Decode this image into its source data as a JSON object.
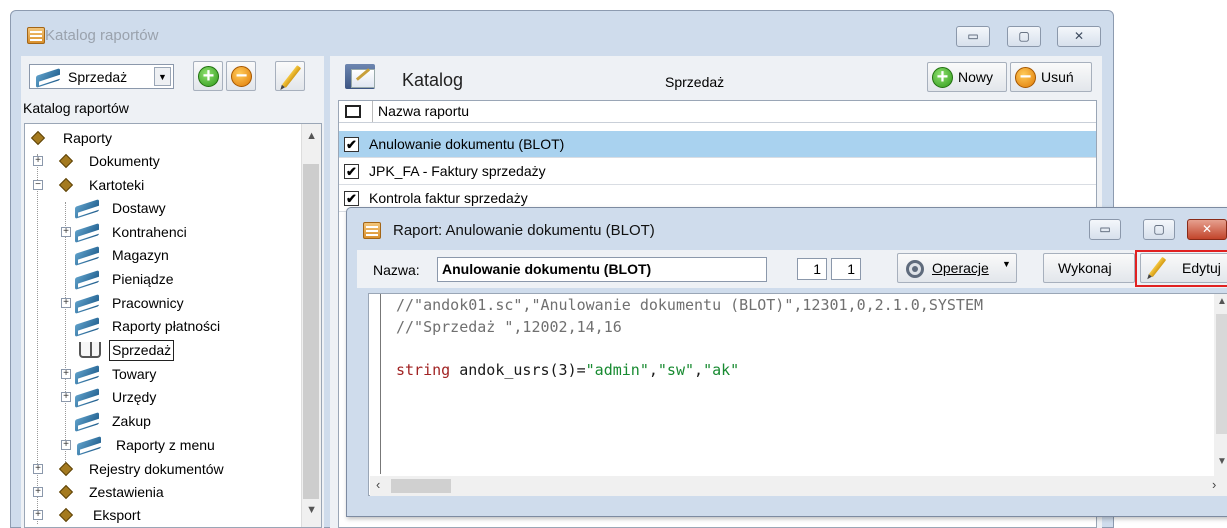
{
  "main_window": {
    "title": "Katalog raportów",
    "min": "▭",
    "max": "▢",
    "close": "✕"
  },
  "left_panel": {
    "combo_value": "Sprzedaż",
    "header": "Katalog raportów",
    "tree": [
      {
        "label": "Raporty"
      },
      {
        "label": "Dokumenty"
      },
      {
        "label": "Kartoteki"
      },
      {
        "label": "Dostawy"
      },
      {
        "label": "Kontrahenci"
      },
      {
        "label": "Magazyn"
      },
      {
        "label": "Pieniądze"
      },
      {
        "label": "Pracownicy"
      },
      {
        "label": "Raporty płatności"
      },
      {
        "label": "Sprzedaż"
      },
      {
        "label": "Towary"
      },
      {
        "label": "Urzędy"
      },
      {
        "label": "Zakup"
      },
      {
        "label": "Raporty z menu"
      },
      {
        "label": "Rejestry dokumentów"
      },
      {
        "label": "Zestawienia"
      },
      {
        "label": "Eksport"
      }
    ]
  },
  "right_panel": {
    "title": "Katalog",
    "subtitle": "Sprzedaż",
    "new_label": "Nowy",
    "delete_label": "Usuń",
    "column_header": "Nazwa raportu",
    "rows": [
      {
        "label": "Anulowanie dokumentu (BLOT)",
        "checked": true
      },
      {
        "label": "JPK_FA - Faktury sprzedaży",
        "checked": true
      },
      {
        "label": "Kontrola faktur sprzedaży",
        "checked": true
      }
    ]
  },
  "dialog": {
    "title": "Raport: Anulowanie dokumentu (BLOT)",
    "name_label": "Nazwa:",
    "name_value": "Anulowanie dokumentu (BLOT)",
    "num1": "1",
    "num2": "1",
    "operations_label": "Operacje",
    "run_label": "Wykonaj",
    "edit_label": "Edytuj",
    "code": {
      "line1": "//\"andok01.sc\",\"Anulowanie dokumentu (BLOT)\",12301,0,2.1.0,SYSTEM",
      "line2": "//\"Sprzedaż \",12002,14,16",
      "kw": "string",
      "decl": " andok_usrs(3)=",
      "s1": "\"admin\"",
      "s2": "\"sw\"",
      "s3": "\"ak\"",
      "comma": ","
    }
  },
  "colors": {
    "selection": "#a9d2ef",
    "highlight_border": "#e12121",
    "keyword": "#a12323",
    "string": "#178a30"
  }
}
